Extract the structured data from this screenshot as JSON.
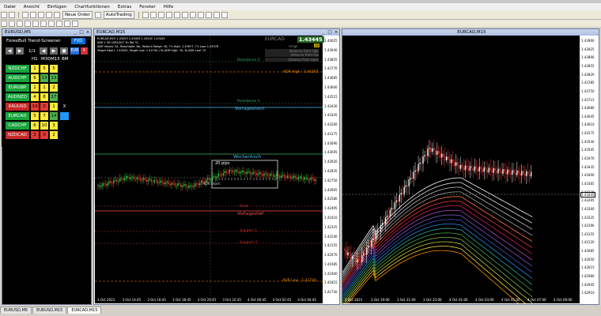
{
  "menu": [
    "Datei",
    "Ansicht",
    "Einfügen",
    "Chartfunktionen",
    "Extras",
    "Fenster",
    "Hilfe"
  ],
  "toolbar": {
    "new_order": "Neue Order",
    "autotrading": "AutoTrading"
  },
  "windows": {
    "left": {
      "title": "EURUSD,M5"
    },
    "middle": {
      "title": "EURCAD,M15"
    },
    "right": {
      "title": "EURCAD,M15"
    }
  },
  "screener": {
    "title": "ForexBull Trend-Screener",
    "fxd": "FXD",
    "page": "1/1",
    "eur_btn": "EUR",
    "x_btn": "X",
    "headers": [
      "H1",
      "M30",
      "M15",
      "BM"
    ],
    "rows": [
      {
        "symbol": "NZDCHF",
        "color": "#17a43a",
        "vals": [
          "1",
          "5",
          "5"
        ],
        "bm": ""
      },
      {
        "symbol": "AUDCHF",
        "color": "#17a43a",
        "vals": [
          "6",
          "13",
          "13"
        ],
        "bm": ""
      },
      {
        "symbol": "EURGBP",
        "color": "#17a43a",
        "vals": [
          "1",
          "1",
          "2"
        ],
        "bm": ""
      },
      {
        "symbol": "AUDNZD",
        "color": "#17a43a",
        "vals": [
          "4",
          "8",
          "17"
        ],
        "bm": ""
      },
      {
        "symbol": "XAUUSD",
        "color": "#c62828",
        "vals": [
          "14",
          "0",
          "1"
        ],
        "bm": "X"
      },
      {
        "symbol": "EURCAD",
        "color": "#17a43a",
        "vals": [
          "5",
          "7",
          "14"
        ],
        "bm": ""
      },
      {
        "symbol": "CADCHF",
        "color": "#17a43a",
        "vals": [
          "6",
          "10",
          "3"
        ],
        "bm": ""
      },
      {
        "symbol": "NZDCAD",
        "color": "#c62828",
        "vals": [
          "3",
          "0",
          "2"
        ],
        "bm": ""
      }
    ]
  },
  "middle_chart": {
    "header_line1": "EURCAD,M15  1.43453 1.43459 1.43445 1.43445",
    "header_line2": "ADR 1.38 2005(527 H) Ref 31",
    "header_line3": "ADR Values: 61, Reachable: No, Today's Range: 28, T's High: 1.43677, T's Low: 1.43378",
    "header_line4": "Target High+ 1.44205, Target Low- 1.42744 | To ADR High: 76, To ADR Low: 70",
    "symbol_box": "EURCAD",
    "price": "1.43445",
    "range_label": "range",
    "range_val": "28",
    "dist_high": "distance from high",
    "dist_low": "distance from low",
    "dist_open": "distance from open",
    "levels": {
      "res2": "Resistance 2",
      "adr_high": "ADR High : 1.44205",
      "res1": "Resistance 1",
      "vortageshoch": "Vortageshoch",
      "wochenhoch": "Wochenhoch",
      "pips": "20 pips",
      "adr_start": "ADR Start",
      "pivot": "Pivot",
      "vortagestief": "Vortagestief",
      "support1": "Support 1",
      "support2": "Support 2",
      "adr_low": "ADR Low : 1.42744"
    },
    "prices": [
      "1.44025",
      "1.43940",
      "1.43855",
      "1.43770",
      "1.43685",
      "1.43600",
      "1.43515",
      "1.43430",
      "1.43345",
      "1.43260",
      "1.43175",
      "1.43090",
      "1.43005",
      "1.42920",
      "1.42835",
      "1.42750",
      "1.42665",
      "1.42580",
      "1.42495",
      "1.42410",
      "1.42325",
      "1.42240",
      "1.42155",
      "1.42070",
      "1.41985",
      "1.41900",
      "1.41815",
      "1.41730"
    ],
    "xlabels": [
      "3 Oct 2023",
      "3 Oct 14:45",
      "3 Oct 16:45",
      "3 Oct 18:45",
      "3 Oct 20:45",
      "3 Oct 22:45",
      "4 Oct 00:45",
      "4 Oct 02:45",
      "4 Oct 04:45"
    ]
  },
  "right_chart": {
    "prices": [
      "1.43960",
      "1.43925",
      "1.43890",
      "1.43855",
      "1.43820",
      "1.43785",
      "1.43750",
      "1.43715",
      "1.43680",
      "1.43645",
      "1.43610",
      "1.43575",
      "1.43540",
      "1.43505",
      "1.43470",
      "1.43435",
      "1.43400",
      "1.43365",
      "1.43330",
      "1.43295",
      "1.43260",
      "1.43225",
      "1.43190",
      "1.43155",
      "1.43120",
      "1.43085",
      "1.43050",
      "1.43015",
      "1.42980",
      "1.42945",
      "1.42910"
    ],
    "current": "1.43445",
    "xlabels": [
      "3 Oct 2023",
      "3 Oct 19:00",
      "3 Oct 21:00",
      "3 Oct 23:00",
      "4 Oct 01:00",
      "4 Oct 03:00",
      "4 Oct 05:00",
      "4 Oct 07:00",
      "4 Oct 09:00"
    ]
  },
  "tabs": [
    "EURUSD,M5",
    "EURUSD,M15",
    "EURCAD,M15"
  ]
}
